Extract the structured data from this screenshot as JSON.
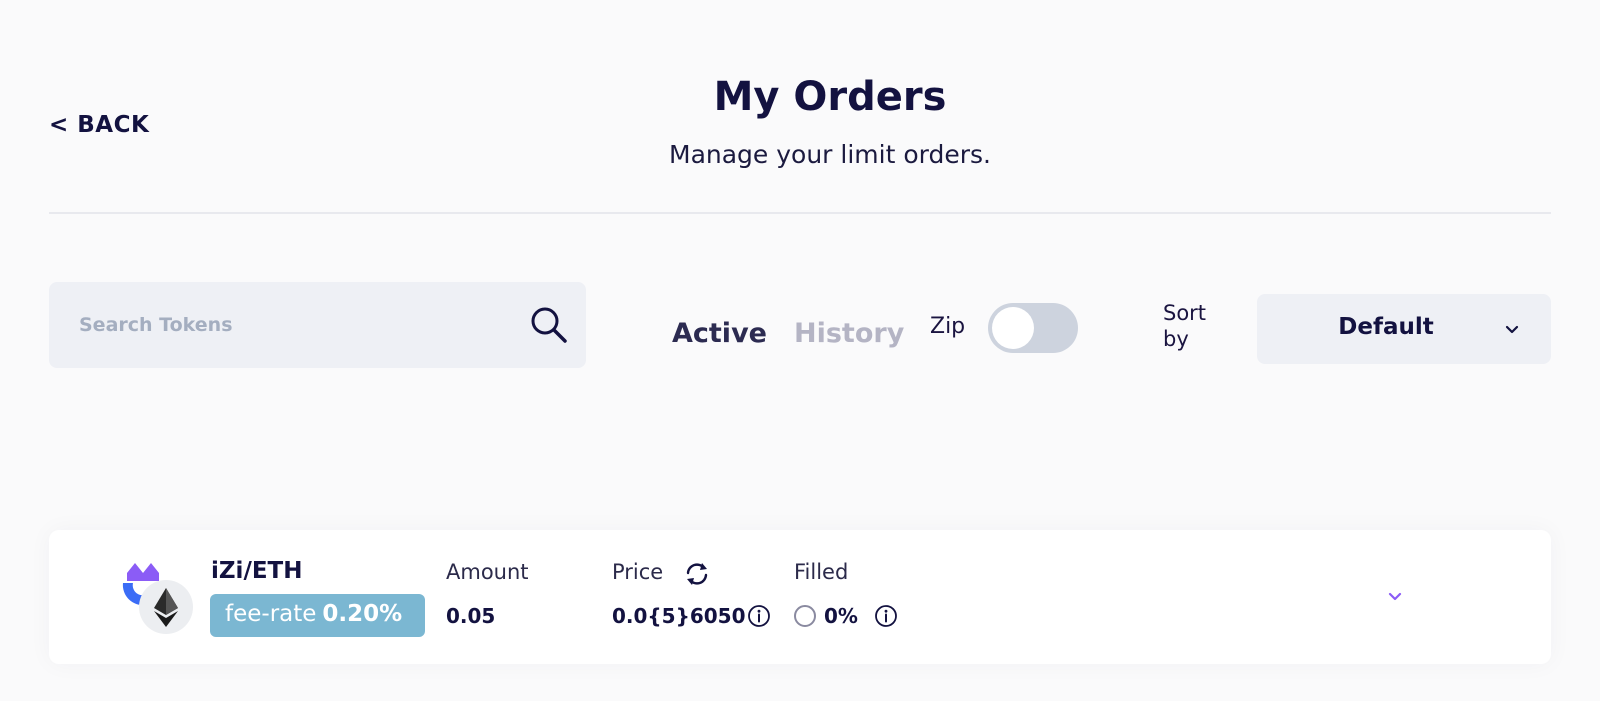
{
  "header": {
    "back_label": "< BACK",
    "title": "My Orders",
    "subtitle": "Manage your limit orders."
  },
  "search": {
    "placeholder": "Search Tokens",
    "value": ""
  },
  "tabs": [
    {
      "label": "Active",
      "selected": true
    },
    {
      "label": "History",
      "selected": false
    }
  ],
  "zip": {
    "label": "Zip",
    "enabled": false
  },
  "sort": {
    "label": "Sort by",
    "value": "Default"
  },
  "orders": [
    {
      "pair": "iZi/ETH",
      "fee_label": "fee-rate",
      "fee_value": "0.20%",
      "amount_label": "Amount",
      "amount": "0.05",
      "price_label": "Price",
      "price": "0.0{5}6050",
      "filled_label": "Filled",
      "filled": "0%"
    }
  ],
  "colors": {
    "primary_text": "#131240",
    "muted_tab": "#b4b4c4",
    "input_bg": "#eef0f5",
    "fee_badge": "#7bb7d2",
    "accent_purple": "#8b5cf6",
    "toggle_off": "#cdd3de"
  },
  "icons": {
    "search": "search-icon",
    "sort": "chevron-down-icon",
    "refresh": "refresh-icon",
    "info": "info-icon",
    "expand": "chevron-down-icon",
    "token_a": "izi-token-icon",
    "token_b": "eth-token-icon"
  }
}
